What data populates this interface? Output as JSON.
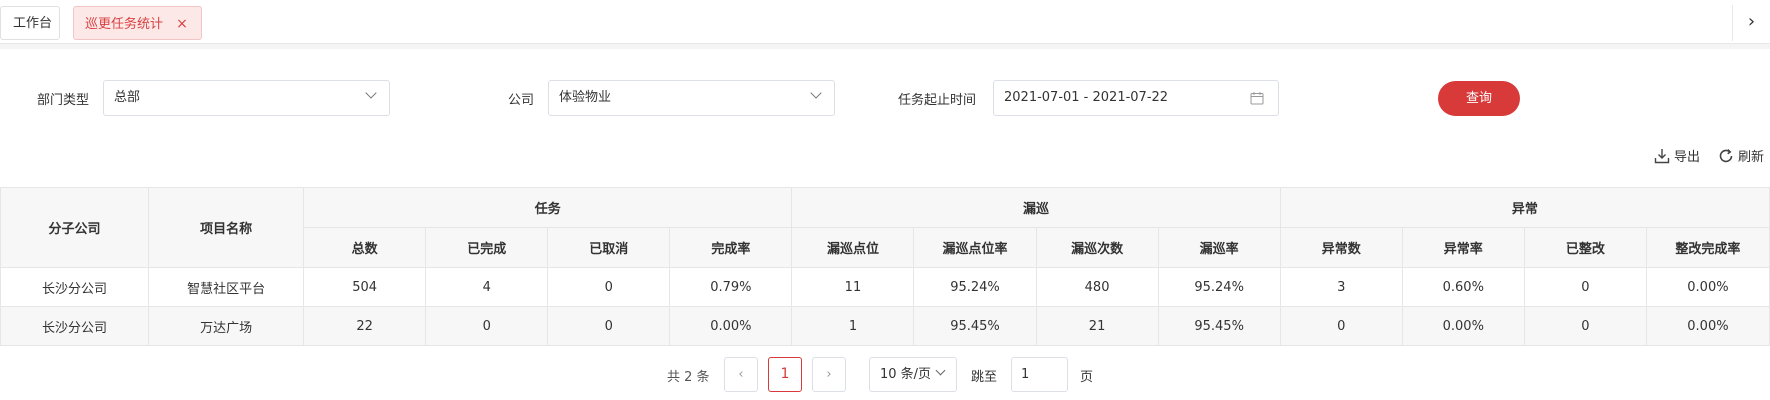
{
  "tabs": {
    "home_label": "工作台",
    "active_label": "巡更任务统计",
    "close_icon": "×",
    "next_icon": "›"
  },
  "filters": {
    "dept_type_label": "部门类型",
    "dept_type_value": "总部",
    "company_label": "公司",
    "company_value": "体验物业",
    "date_label": "任务起止时间",
    "date_value": "2021-07-01 - 2021-07-22",
    "query_label": "查询"
  },
  "toolbar": {
    "export_label": "导出",
    "refresh_label": "刷新"
  },
  "table": {
    "col_branch": "分子公司",
    "col_project": "项目名称",
    "group_task": "任务",
    "group_missed": "漏巡",
    "group_abnormal": "异常",
    "sub_headers": [
      "总数",
      "已完成",
      "已取消",
      "完成率",
      "漏巡点位",
      "漏巡点位率",
      "漏巡次数",
      "漏巡率",
      "异常数",
      "异常率",
      "已整改",
      "整改完成率"
    ],
    "rows": [
      [
        "长沙分公司",
        "智慧社区平台",
        "504",
        "4",
        "0",
        "0.79%",
        "11",
        "95.24%",
        "480",
        "95.24%",
        "3",
        "0.60%",
        "0",
        "0.00%"
      ],
      [
        "长沙分公司",
        "万达广场",
        "22",
        "0",
        "0",
        "0.00%",
        "1",
        "95.45%",
        "21",
        "95.45%",
        "0",
        "0.00%",
        "0",
        "0.00%"
      ]
    ]
  },
  "pagination": {
    "total_label": "共 2 条",
    "current_page": "1",
    "page_size": "10 条/页",
    "jump_label": "跳至",
    "jump_value": "1",
    "page_unit": "页",
    "prev_icon": "‹",
    "next_icon": "›"
  },
  "colors": {
    "accent": "#d83a3a",
    "tab_active_bg": "#fde8e8",
    "header_bg": "#f7f7f7"
  }
}
